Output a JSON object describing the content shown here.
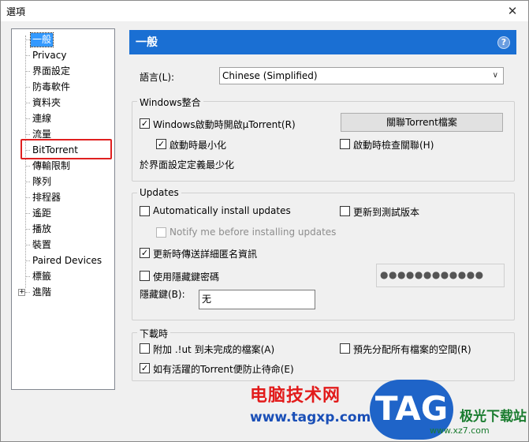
{
  "window": {
    "title": "選項",
    "close_glyph": "✕"
  },
  "tree": {
    "items": [
      {
        "label": "一般",
        "selected": true
      },
      {
        "label": "Privacy"
      },
      {
        "label": "界面設定"
      },
      {
        "label": "防毒軟件"
      },
      {
        "label": "資料夾"
      },
      {
        "label": "連線"
      },
      {
        "label": "流量"
      },
      {
        "label": "BitTorrent"
      },
      {
        "label": "傳輸限制"
      },
      {
        "label": "隊列"
      },
      {
        "label": "排程器"
      },
      {
        "label": "遙距"
      },
      {
        "label": "播放"
      },
      {
        "label": "裝置"
      },
      {
        "label": "Paired Devices"
      },
      {
        "label": "標籤"
      },
      {
        "label": "進階",
        "expandable": true
      }
    ],
    "expand_glyph": "+"
  },
  "header": {
    "title": "一般",
    "help_glyph": "?"
  },
  "language": {
    "label": "語言(L):",
    "value": "Chinese (Simplified)"
  },
  "windows_group": {
    "title": "Windows整合",
    "start_with_windows": "Windows啟動時開啟µTorrent(R)",
    "start_minimized": "啟動時最小化",
    "associate_button": "關聯Torrent檔案",
    "check_association": "啟動時檢查關聯(H)",
    "minimize_note": "於界面設定定義最少化"
  },
  "updates_group": {
    "title": "Updates",
    "auto_install": "Automatically install updates",
    "beta": "更新到測試版本",
    "notify_before": "Notify me before installing updates",
    "send_details": "更新時傳送詳細匿名資訊",
    "use_stealth_pw": "使用隱藏鍵密碼",
    "stealth_label": "隱藏鍵(B):",
    "stealth_value": "无",
    "password_mask": "●●●●●●●●●●●●"
  },
  "download_group": {
    "title": "下載時",
    "append_ut": "附加 .!ut 到未完成的檔案(A)",
    "preallocate": "預先分配所有檔案的空間(R)",
    "prevent_standby": "如有活躍的Torrent便防止待命(E)"
  },
  "watermark": {
    "cn": "电脑技术网",
    "url": "www.tagxp.com",
    "badge": "TAG",
    "right": "极光下载站",
    "right_url": "www.xz7.com"
  },
  "colors": {
    "header_blue": "#1a6fd3",
    "selection_blue": "#3399ff",
    "highlight_red": "#e02020"
  }
}
